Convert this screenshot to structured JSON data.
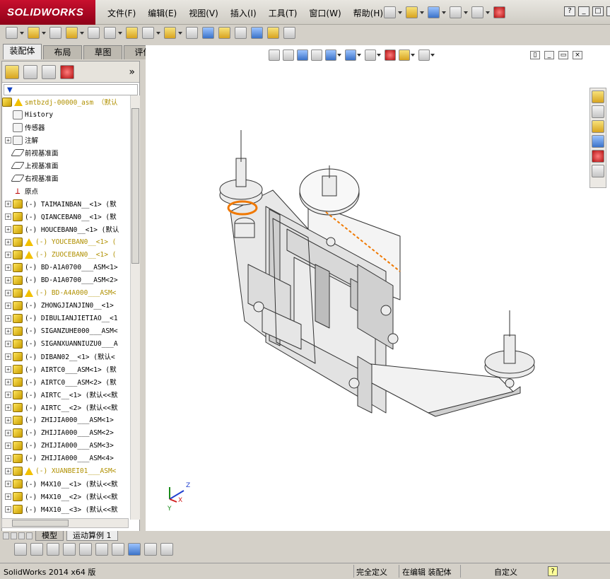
{
  "app": {
    "logo": "SOLIDWORKS"
  },
  "menus": [
    "文件(F)",
    "编辑(E)",
    "视图(V)",
    "插入(I)",
    "工具(T)",
    "窗口(W)",
    "帮助(H)"
  ],
  "window_controls": [
    "?",
    "_",
    "□",
    "×"
  ],
  "tabs": [
    "装配体",
    "布局",
    "草图",
    "评估"
  ],
  "tree": {
    "root": "smtbzdj-00000_asm （默认",
    "items": [
      {
        "label": "History",
        "icon": "history-icon",
        "expand": false
      },
      {
        "label": "传感器",
        "icon": "sensor-icon",
        "expand": false
      },
      {
        "label": "注解",
        "icon": "annotation-icon",
        "expand": true
      },
      {
        "label": "前视基准面",
        "icon": "plane-icon",
        "expand": false
      },
      {
        "label": "上视基准面",
        "icon": "plane-icon",
        "expand": false
      },
      {
        "label": "右视基准面",
        "icon": "plane-icon",
        "expand": false
      },
      {
        "label": "原点",
        "icon": "origin-icon",
        "expand": false
      },
      {
        "label": "(-) TAIMAINBAN__<1> (默",
        "warn": false
      },
      {
        "label": "(-) QIANCEBAN0__<1> (默",
        "warn": false
      },
      {
        "label": "(-) HOUCEBAN0__<1> (默认",
        "warn": false
      },
      {
        "label": "(-) YOUCEBAN0__<1> (",
        "warn": true
      },
      {
        "label": "(-) ZUOCEBAN0__<1> (",
        "warn": true
      },
      {
        "label": "(-) BD-A1A0700___ASM<1>",
        "warn": false
      },
      {
        "label": "(-) BD-A1A0700___ASM<2>",
        "warn": false
      },
      {
        "label": "(-) BD-A4A000___ASM<",
        "warn": true
      },
      {
        "label": "(-) ZHONGJIANJIN0__<1>",
        "warn": false
      },
      {
        "label": "(-) DIBULIANJIETIAO__<1",
        "warn": false
      },
      {
        "label": "(-) SIGANZUHE000___ASM<",
        "warn": false
      },
      {
        "label": "(-) SIGANXUANNIUZU0___A",
        "warn": false
      },
      {
        "label": "(-) DIBAN02__<1> (默认<",
        "warn": false
      },
      {
        "label": "(-) AIRTC0___ASM<1> (默",
        "warn": false
      },
      {
        "label": "(-) AIRTC0___ASM<2> (默",
        "warn": false
      },
      {
        "label": "(-) AIRTC__<1> (默认<<默",
        "warn": false
      },
      {
        "label": "(-) AIRTC__<2> (默认<<默",
        "warn": false
      },
      {
        "label": "(-) ZHIJIA000___ASM<1>",
        "warn": false
      },
      {
        "label": "(-) ZHIJIA000___ASM<2>",
        "warn": false
      },
      {
        "label": "(-) ZHIJIA000___ASM<3>",
        "warn": false
      },
      {
        "label": "(-) ZHIJIA000___ASM<4>",
        "warn": false
      },
      {
        "label": "(-) XUANBEI01___ASM<",
        "warn": true
      },
      {
        "label": "(-) M4X10__<1> (默认<<默",
        "warn": false
      },
      {
        "label": "(-) M4X10__<2> (默认<<默",
        "warn": false
      },
      {
        "label": "(-) M4X10__<3> (默认<<默",
        "warn": false
      }
    ]
  },
  "bottom_tabs": [
    "模型",
    "运动算例 1"
  ],
  "triad": {
    "x": "X",
    "y": "Y",
    "z": "Z"
  },
  "status": {
    "app": "SolidWorks 2014 x64 版",
    "defined": "完全定义",
    "editing": "在编辑 装配体",
    "units": "自定义",
    "help": "?"
  },
  "colors": {
    "accent": "#c8102e",
    "warning": "#f2c000",
    "selection": "#f07800"
  }
}
